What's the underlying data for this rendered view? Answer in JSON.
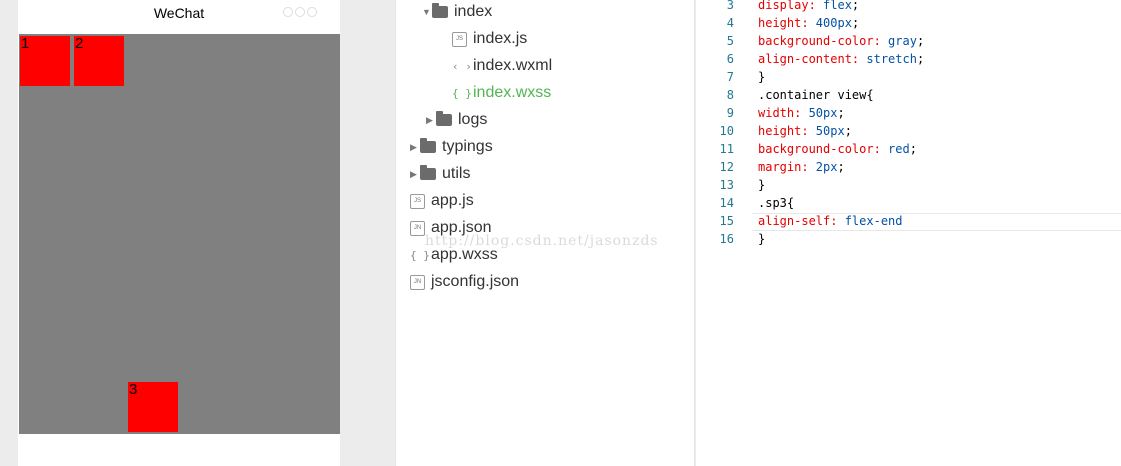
{
  "simulator": {
    "title": "WeChat",
    "boxes": [
      "1",
      "2",
      "3"
    ]
  },
  "file_tree": [
    {
      "name": "index",
      "kind": "folder-open"
    },
    {
      "name": "index.js",
      "kind": "js"
    },
    {
      "name": "index.wxml",
      "kind": "wxml"
    },
    {
      "name": "index.wxss",
      "kind": "wxss",
      "active": true
    },
    {
      "name": "logs",
      "kind": "folder"
    },
    {
      "name": "typings",
      "kind": "folder"
    },
    {
      "name": "utils",
      "kind": "folder"
    },
    {
      "name": "app.js",
      "kind": "js"
    },
    {
      "name": "app.json",
      "kind": "json"
    },
    {
      "name": "app.wxss",
      "kind": "wxss"
    },
    {
      "name": "jsconfig.json",
      "kind": "json"
    }
  ],
  "file_icon_labels": {
    "js": "JS",
    "json": "JN",
    "wxml": "‹ ›",
    "wxss": "{ }"
  },
  "editor": {
    "line_numbers": [
      "3",
      "4",
      "5",
      "6",
      "7",
      "8",
      "9",
      "10",
      "11",
      "12",
      "13",
      "14",
      "15",
      "16"
    ],
    "lines": [
      {
        "prop": "display:",
        "val": " flex",
        "rest": ";"
      },
      {
        "prop": "height:",
        "val": " 400px",
        "rest": ";"
      },
      {
        "prop": "background-color:",
        "val": " gray",
        "rest": ";"
      },
      {
        "prop": "align-content:",
        "val": " stretch",
        "rest": ";"
      },
      {
        "prop": "",
        "val": "",
        "rest": "}"
      },
      {
        "prop": "",
        "val": "",
        "rest": ".container view{"
      },
      {
        "prop": "width:",
        "val": " 50px",
        "rest": ";"
      },
      {
        "prop": "height:",
        "val": " 50px",
        "rest": ";"
      },
      {
        "prop": "background-color:",
        "val": " red",
        "rest": ";"
      },
      {
        "prop": "margin:",
        "val": " 2px",
        "rest": ";"
      },
      {
        "prop": "",
        "val": "",
        "rest": "}"
      },
      {
        "prop": "",
        "val": "",
        "rest": ".sp3{"
      },
      {
        "prop": "align-self:",
        "val": " flex-end",
        "rest": ""
      },
      {
        "prop": "",
        "val": "",
        "rest": "}"
      }
    ]
  },
  "watermark": "http://blog.csdn.net/jasonzds",
  "colors": {
    "container": "#808080",
    "box": "#ff0000",
    "active_file": "#52b552"
  }
}
